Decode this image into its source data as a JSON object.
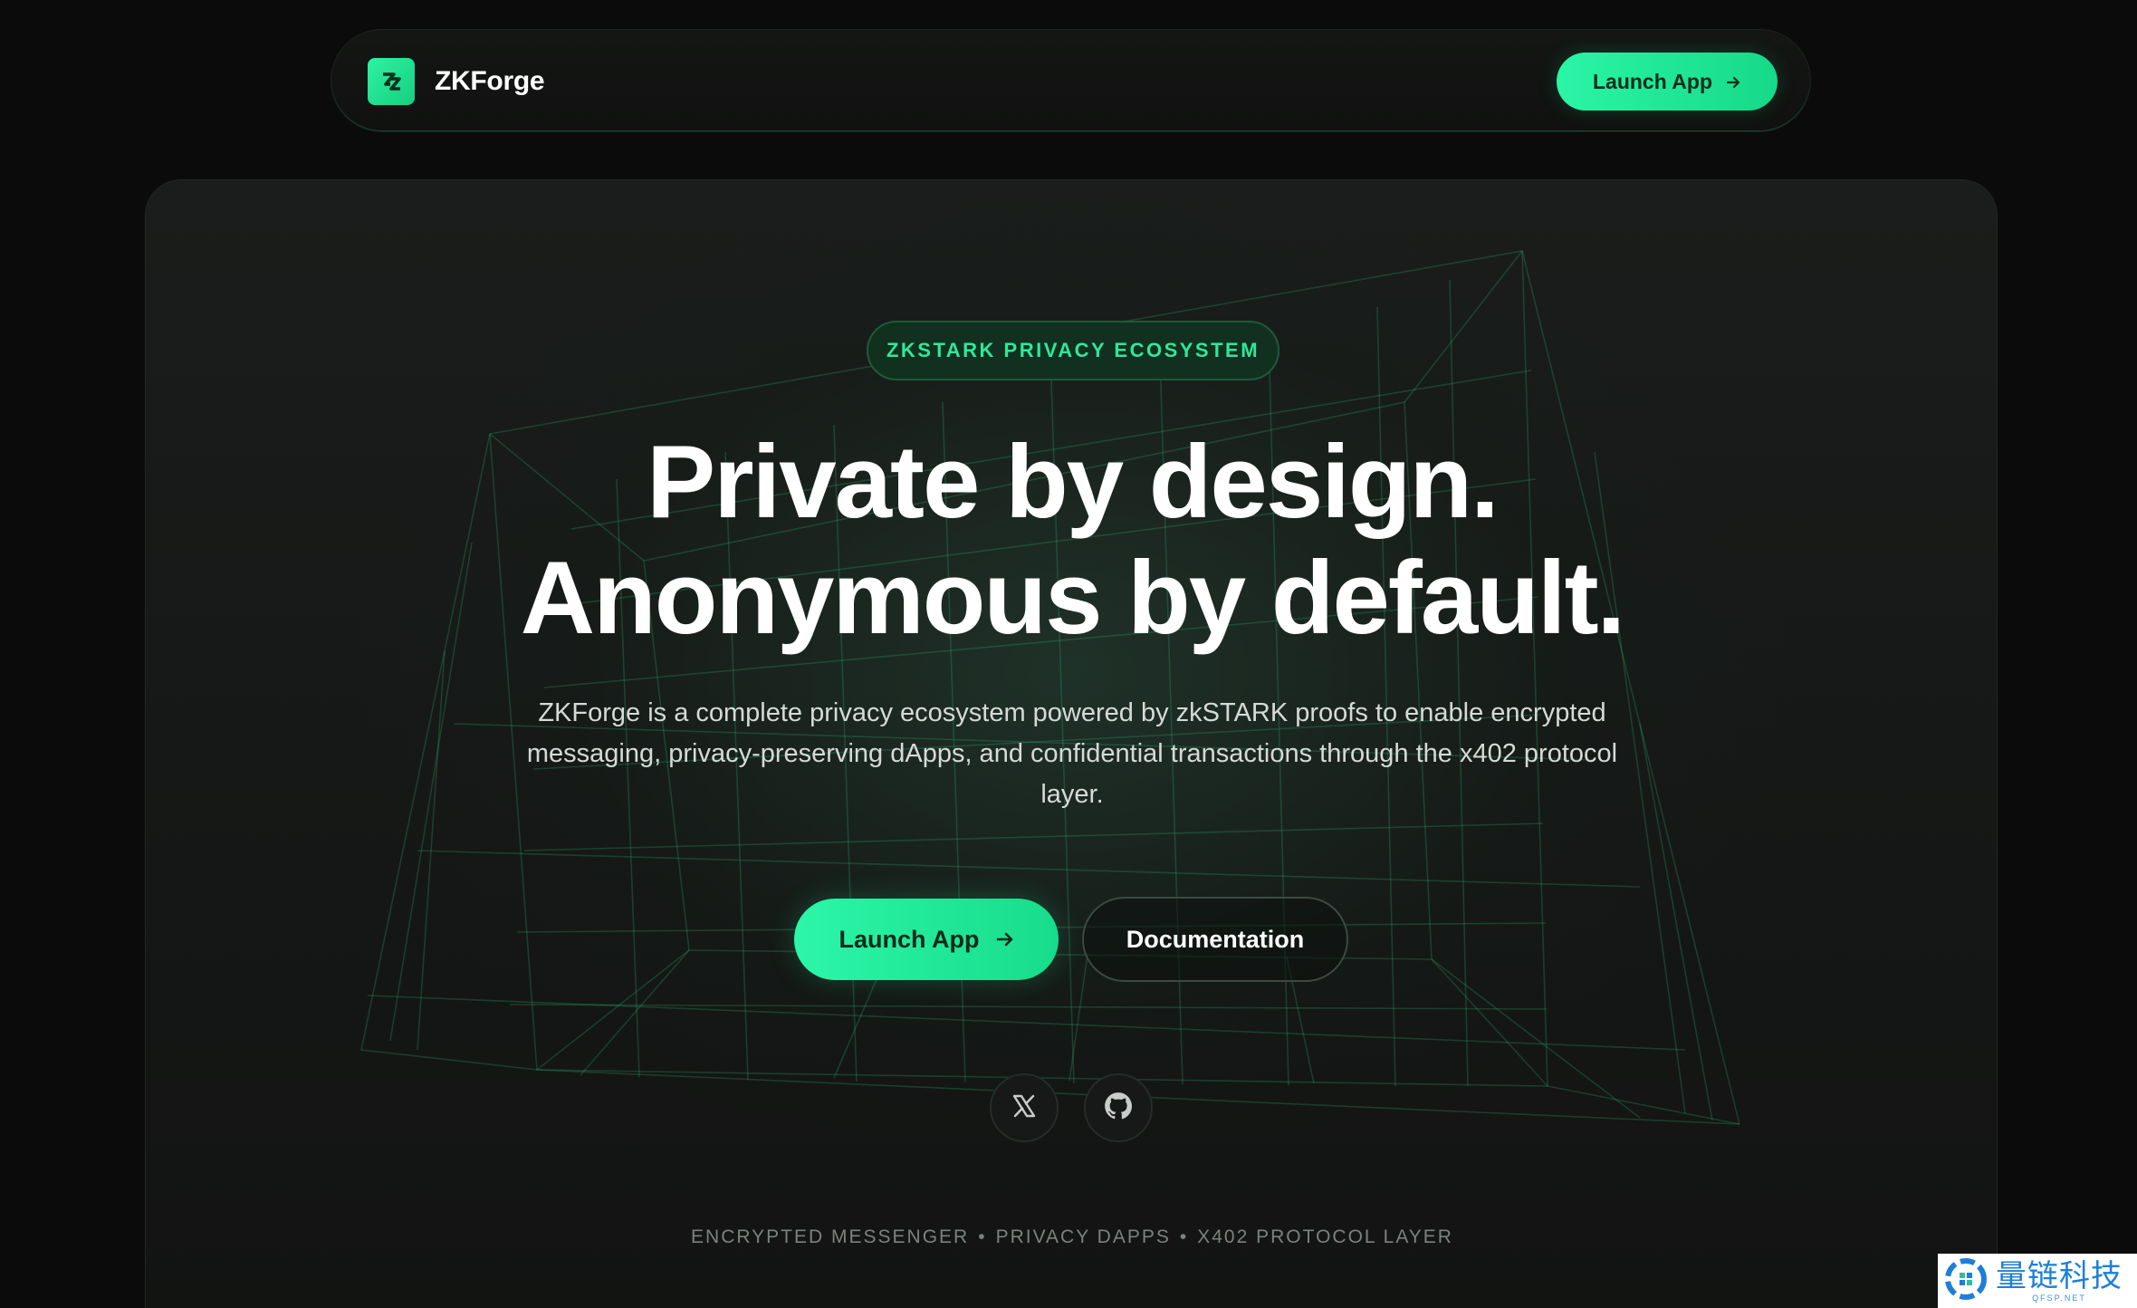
{
  "nav": {
    "brand_name": "ZKForge",
    "launch_label": "Launch App",
    "logo_icon": "zk-logo-icon",
    "arrow_icon": "arrow-right-icon"
  },
  "hero": {
    "badge": "ZKSTARK PRIVACY ECOSYSTEM",
    "headline_line1": "Private by design.",
    "headline_line2": "Anonymous by default.",
    "description": "ZKForge is a complete privacy ecosystem powered by zkSTARK proofs to enable encrypted messaging, privacy-preserving dApps, and confidential transactions through the x402 protocol layer.",
    "primary_cta": "Launch App",
    "secondary_cta": "Documentation",
    "social": [
      {
        "icon": "x-twitter-icon"
      },
      {
        "icon": "github-icon"
      }
    ],
    "features": [
      "ENCRYPTED MESSENGER",
      "PRIVACY DAPPS",
      "X402 PROTOCOL LAYER"
    ],
    "feature_separator": "•"
  },
  "watermark": {
    "chinese": "量链科技",
    "english": "QFSP.NET"
  },
  "colors": {
    "accent": "#22e897",
    "background": "#0b0b0b",
    "card": "#171a18",
    "badge_text": "#2ee89b"
  }
}
